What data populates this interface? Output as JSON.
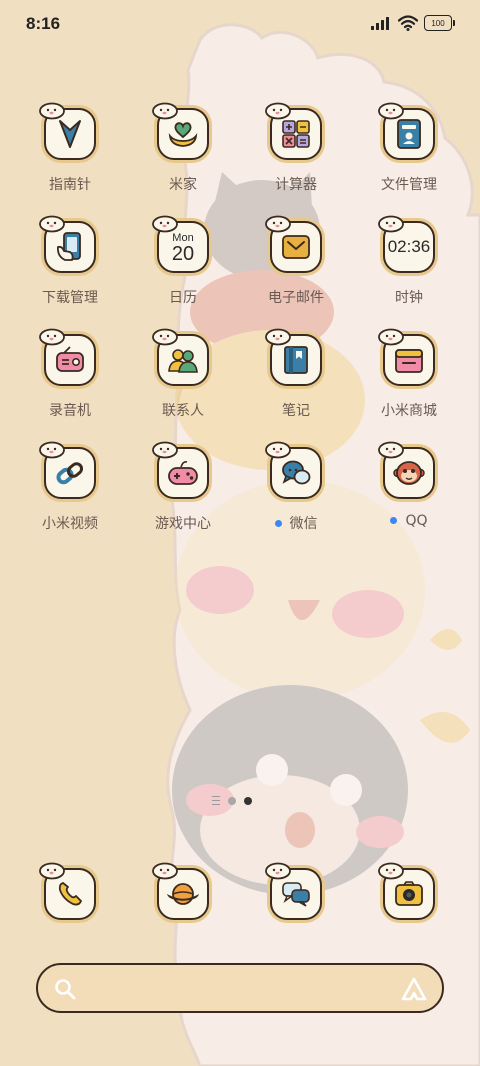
{
  "status_bar": {
    "time": "8:16",
    "battery": "100"
  },
  "apps": [
    {
      "id": "compass",
      "label": "指南针"
    },
    {
      "id": "mijia",
      "label": "米家"
    },
    {
      "id": "calculator",
      "label": "计算器"
    },
    {
      "id": "files",
      "label": "文件管理"
    },
    {
      "id": "downloads",
      "label": "下载管理"
    },
    {
      "id": "calendar",
      "label": "日历",
      "icon_month": "Mon",
      "icon_day": "20"
    },
    {
      "id": "email",
      "label": "电子邮件"
    },
    {
      "id": "clock",
      "label": "时钟",
      "icon_time": "02:36"
    },
    {
      "id": "recorder",
      "label": "录音机"
    },
    {
      "id": "contacts",
      "label": "联系人"
    },
    {
      "id": "notes",
      "label": "笔记"
    },
    {
      "id": "mistore",
      "label": "小米商城"
    },
    {
      "id": "mivideo",
      "label": "小米视频"
    },
    {
      "id": "gamecenter",
      "label": "游戏中心"
    },
    {
      "id": "wechat",
      "label": "微信",
      "new_badge": true
    },
    {
      "id": "qq",
      "label": "QQ",
      "new_badge": true
    }
  ],
  "dock": [
    {
      "id": "phone"
    },
    {
      "id": "browser"
    },
    {
      "id": "messages"
    },
    {
      "id": "camera"
    }
  ],
  "pager": {
    "pages": 2,
    "current": 2
  },
  "search": {
    "placeholder": ""
  },
  "icons": {
    "compass": "compass-needle-icon",
    "mijia": "heart-hands-icon",
    "calculator": "calculator-icon",
    "files": "folder-id-icon",
    "downloads": "phone-hand-icon",
    "email": "envelope-icon",
    "recorder": "radio-icon",
    "contacts": "people-icon",
    "notes": "book-icon",
    "mistore": "store-icon",
    "mivideo": "chain-link-icon",
    "gamecenter": "gamepad-icon",
    "wechat": "chat-bubbles-icon",
    "qq": "monkey-face-icon",
    "phone": "phone-icon",
    "browser": "planet-icon",
    "messages": "message-bubbles-icon",
    "camera": "camera-icon",
    "search": "search-icon",
    "assistant": "ai-assistant-icon"
  },
  "colors": {
    "background": "#f1dfc2",
    "tile": "#fbf6ea",
    "outline": "#3a2a1f",
    "badge": "#3d86f5",
    "label": "#6a5a50"
  }
}
